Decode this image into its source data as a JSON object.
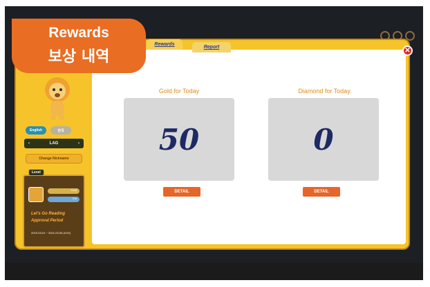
{
  "badge": {
    "title": "Rewards",
    "subtitle": "보상 내역"
  },
  "tabs": [
    {
      "label": "Rewards"
    },
    {
      "label": "Report"
    }
  ],
  "sidebar": {
    "lang_left": "English",
    "lang_right": "한국",
    "level_label": "LAG",
    "change_button": "Change Nickname",
    "card": {
      "tag": "Level",
      "pill_a": "Gold",
      "pill_b": "Dia",
      "title": "Let's Go Reading Approval Period",
      "date": "2019-03-01 ~ 2021-03-06 (XXX)"
    }
  },
  "gold": {
    "title": "Gold for Today",
    "value": "50",
    "detail": "DETAIL"
  },
  "diamond": {
    "title": "Diamond for Today",
    "value": "0",
    "detail": "DETAIL"
  },
  "close_icon": "close-icon"
}
